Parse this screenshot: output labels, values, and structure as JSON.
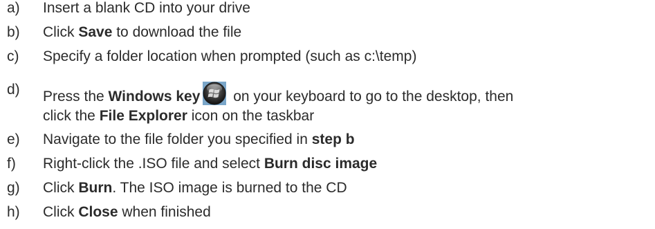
{
  "steps": [
    {
      "marker": "a)",
      "parts": [
        "Insert a blank CD into your drive"
      ]
    },
    {
      "marker": "b)",
      "parts": [
        "Click ",
        "Save",
        " to download the file"
      ]
    },
    {
      "marker": "c)",
      "parts": [
        "Specify a folder location when prompted (such as c:\\temp)"
      ]
    },
    {
      "marker": "d)",
      "parts": [
        "Press the ",
        "Windows key",
        " on your keyboard to go to the desktop, then",
        "click the ",
        "File Explorer",
        " icon on the taskbar"
      ]
    },
    {
      "marker": "e)",
      "parts": [
        "Navigate to the file folder you specified in ",
        "step b"
      ]
    },
    {
      "marker": "f)",
      "parts": [
        "Right-click the .ISO file and select ",
        "Burn disc image"
      ]
    },
    {
      "marker": "g)",
      "parts": [
        "Click ",
        "Burn",
        ". The ISO image is burned to the CD"
      ]
    },
    {
      "marker": "h)",
      "parts": [
        "Click ",
        "Close",
        " when finished"
      ]
    }
  ],
  "icons": {
    "windows_key": "windows-start-orb-icon"
  }
}
